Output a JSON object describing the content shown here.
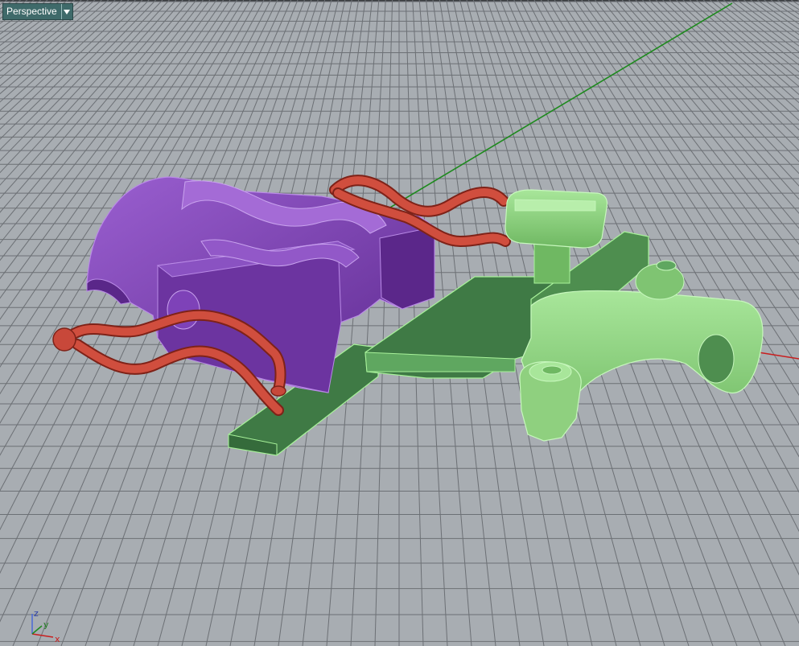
{
  "viewport": {
    "title": "Perspective",
    "dropdown_icon": "triangle-down-icon"
  },
  "axis_widget": {
    "z_label": "z",
    "y_label": "y",
    "x_label": "x"
  },
  "colors": {
    "background": "#a8adb2",
    "grid": "#6c7075",
    "x_axis": "#c82020",
    "y_axis": "#1e8a1e",
    "purple_part": "#7b3fb0",
    "green_part": "#8fd07f",
    "red_clip": "#c8483a",
    "dark_green_base": "#3f7a45",
    "tab_bg": "#3f6a6a"
  }
}
